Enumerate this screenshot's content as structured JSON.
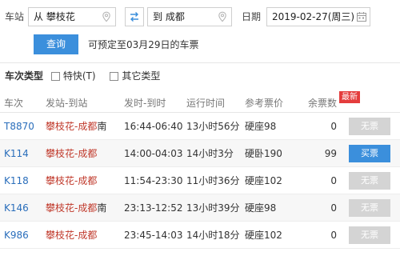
{
  "search": {
    "station_label": "车站",
    "from_value": "从 攀枝花",
    "to_value": "到 成都",
    "date_label": "日期",
    "date_value": "2019-02-27(周三)",
    "query_button": "查询",
    "presale_hint": "可预定至03月29日的车票"
  },
  "filters": {
    "title": "车次类型",
    "options": [
      {
        "label": "特快(T)",
        "checked": false
      },
      {
        "label": "其它类型",
        "checked": false
      }
    ]
  },
  "table": {
    "headers": {
      "train_no": "车次",
      "stations": "发站-到站",
      "times": "发时-到时",
      "duration": "运行时间",
      "price": "参考票价",
      "remaining": "余票数",
      "new_badge": "最新"
    },
    "rows": [
      {
        "train_no": "T8870",
        "stations": "攀枝花-成都",
        "suffix": "南",
        "times": "16:44-06:40",
        "duration": "13小时56分",
        "price": "硬座98",
        "remaining": "0",
        "action": "无票",
        "available": false
      },
      {
        "train_no": "K114",
        "stations": "攀枝花-成都",
        "suffix": "",
        "times": "14:00-04:03",
        "duration": "14小时3分",
        "price": "硬卧190",
        "remaining": "99",
        "action": "买票",
        "available": true
      },
      {
        "train_no": "K118",
        "stations": "攀枝花-成都",
        "suffix": "",
        "times": "11:54-23:30",
        "duration": "11小时36分",
        "price": "硬座102",
        "remaining": "0",
        "action": "无票",
        "available": false
      },
      {
        "train_no": "K146",
        "stations": "攀枝花-成都",
        "suffix": "南",
        "times": "23:13-12:52",
        "duration": "13小时39分",
        "price": "硬座98",
        "remaining": "0",
        "action": "无票",
        "available": false
      },
      {
        "train_no": "K986",
        "stations": "攀枝花-成都",
        "suffix": "",
        "times": "23:45-14:03",
        "duration": "14小时18分",
        "price": "硬座102",
        "remaining": "0",
        "action": "无票",
        "available": false
      }
    ]
  },
  "colors": {
    "accent": "#3b8fdc",
    "train_no": "#2a6ebb",
    "station": "#c0392b",
    "badge": "#e43c3c",
    "disabled_button": "#d4d4d4"
  },
  "icons": {
    "location": "location-pin-icon",
    "swap": "swap-arrows-icon",
    "calendar": "calendar-icon"
  }
}
